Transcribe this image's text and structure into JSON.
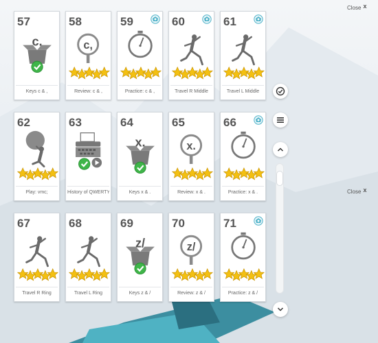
{
  "close_buttons": [
    {
      "label": "Close",
      "x_mark": "x"
    },
    {
      "label": "Close",
      "x_mark": "x"
    }
  ],
  "side_controls": [
    {
      "icon": "check-circle-icon"
    },
    {
      "icon": "menu-icon"
    },
    {
      "icon": "chevron-up-icon"
    },
    {
      "icon": "chevron-down-icon"
    }
  ],
  "cards": [
    {
      "number": "57",
      "art": "box",
      "glyph": "c,",
      "label": "Keys c & ,",
      "badge": false
    },
    {
      "number": "58",
      "art": "magnifier",
      "glyph": "c,",
      "label": "Review: c & ,",
      "badge": false
    },
    {
      "number": "59",
      "art": "stopwatch",
      "glyph": "",
      "label": "Practice: c & ,",
      "badge": true
    },
    {
      "number": "60",
      "art": "runner",
      "glyph": "",
      "label": "Travel R Middle",
      "badge": true
    },
    {
      "number": "61",
      "art": "runner",
      "glyph": "",
      "label": "Travel L Middle",
      "badge": true
    },
    {
      "number": "62",
      "art": "atlas",
      "glyph": "",
      "label": "Play: vmc;",
      "badge": false
    },
    {
      "number": "63",
      "art": "typewriter",
      "glyph": "",
      "label": "History of QWERTY",
      "badge": false
    },
    {
      "number": "64",
      "art": "box",
      "glyph": "x.",
      "label": "Keys x & .",
      "badge": false
    },
    {
      "number": "65",
      "art": "magnifier",
      "glyph": "x.",
      "label": "Review: x & .",
      "badge": false
    },
    {
      "number": "66",
      "art": "stopwatch",
      "glyph": "",
      "label": "Practice: x & .",
      "badge": true
    },
    {
      "number": "67",
      "art": "runner",
      "glyph": "",
      "label": "Travel R Ring",
      "badge": false
    },
    {
      "number": "68",
      "art": "runner",
      "glyph": "",
      "label": "Travel L Ring",
      "badge": false
    },
    {
      "number": "69",
      "art": "box",
      "glyph": "z/",
      "label": "Keys z & /",
      "badge": false
    },
    {
      "number": "70",
      "art": "magnifier",
      "glyph": "z/",
      "label": "Review: z & /",
      "badge": false
    },
    {
      "number": "71",
      "art": "stopwatch",
      "glyph": "",
      "label": "Practice: z & /",
      "badge": true
    }
  ]
}
